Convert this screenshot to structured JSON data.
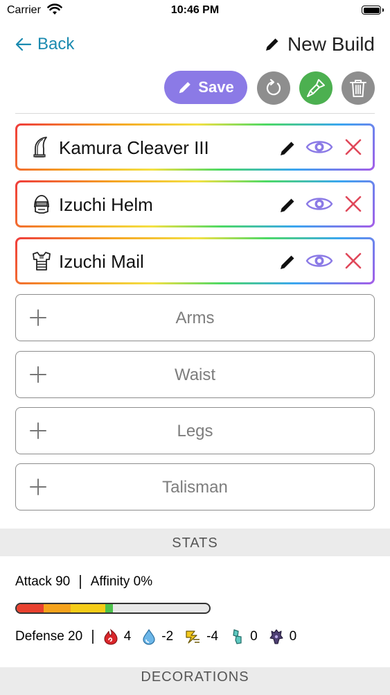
{
  "status_bar": {
    "carrier": "Carrier",
    "time": "10:46 PM"
  },
  "nav": {
    "back_label": "Back",
    "title": "New Build"
  },
  "toolbar": {
    "save_label": "Save",
    "accent": "#8b7ae6",
    "reset_color": "#8e8e8e",
    "paint_color": "#4cb050",
    "delete_color": "#8e8e8e"
  },
  "equipped": [
    {
      "name": "Kamura Cleaver III",
      "icon": "great-sword-icon"
    },
    {
      "name": "Izuchi Helm",
      "icon": "helm-icon"
    },
    {
      "name": "Izuchi Mail",
      "icon": "chest-armor-icon"
    }
  ],
  "empty_slots": [
    "Arms",
    "Waist",
    "Legs",
    "Talisman"
  ],
  "stats": {
    "header": "STATS",
    "attack": "Attack 90",
    "affinity": "Affinity 0%",
    "defense": "Defense 20",
    "resistances": [
      {
        "element": "fire",
        "icon": "fire-icon",
        "value": "4"
      },
      {
        "element": "water",
        "icon": "water-icon",
        "value": "-2"
      },
      {
        "element": "thunder",
        "icon": "thunder-icon",
        "value": "-4"
      },
      {
        "element": "ice",
        "icon": "ice-icon",
        "value": "0"
      },
      {
        "element": "dragon",
        "icon": "dragon-icon",
        "value": "0"
      }
    ],
    "sharpness": [
      {
        "color": "#e8412f",
        "fraction": 0.14
      },
      {
        "color": "#f5a21b",
        "fraction": 0.14
      },
      {
        "color": "#f5cc17",
        "fraction": 0.18
      },
      {
        "color": "#4cc14b",
        "fraction": 0.04
      }
    ]
  },
  "decorations": {
    "header": "DECORATIONS"
  }
}
